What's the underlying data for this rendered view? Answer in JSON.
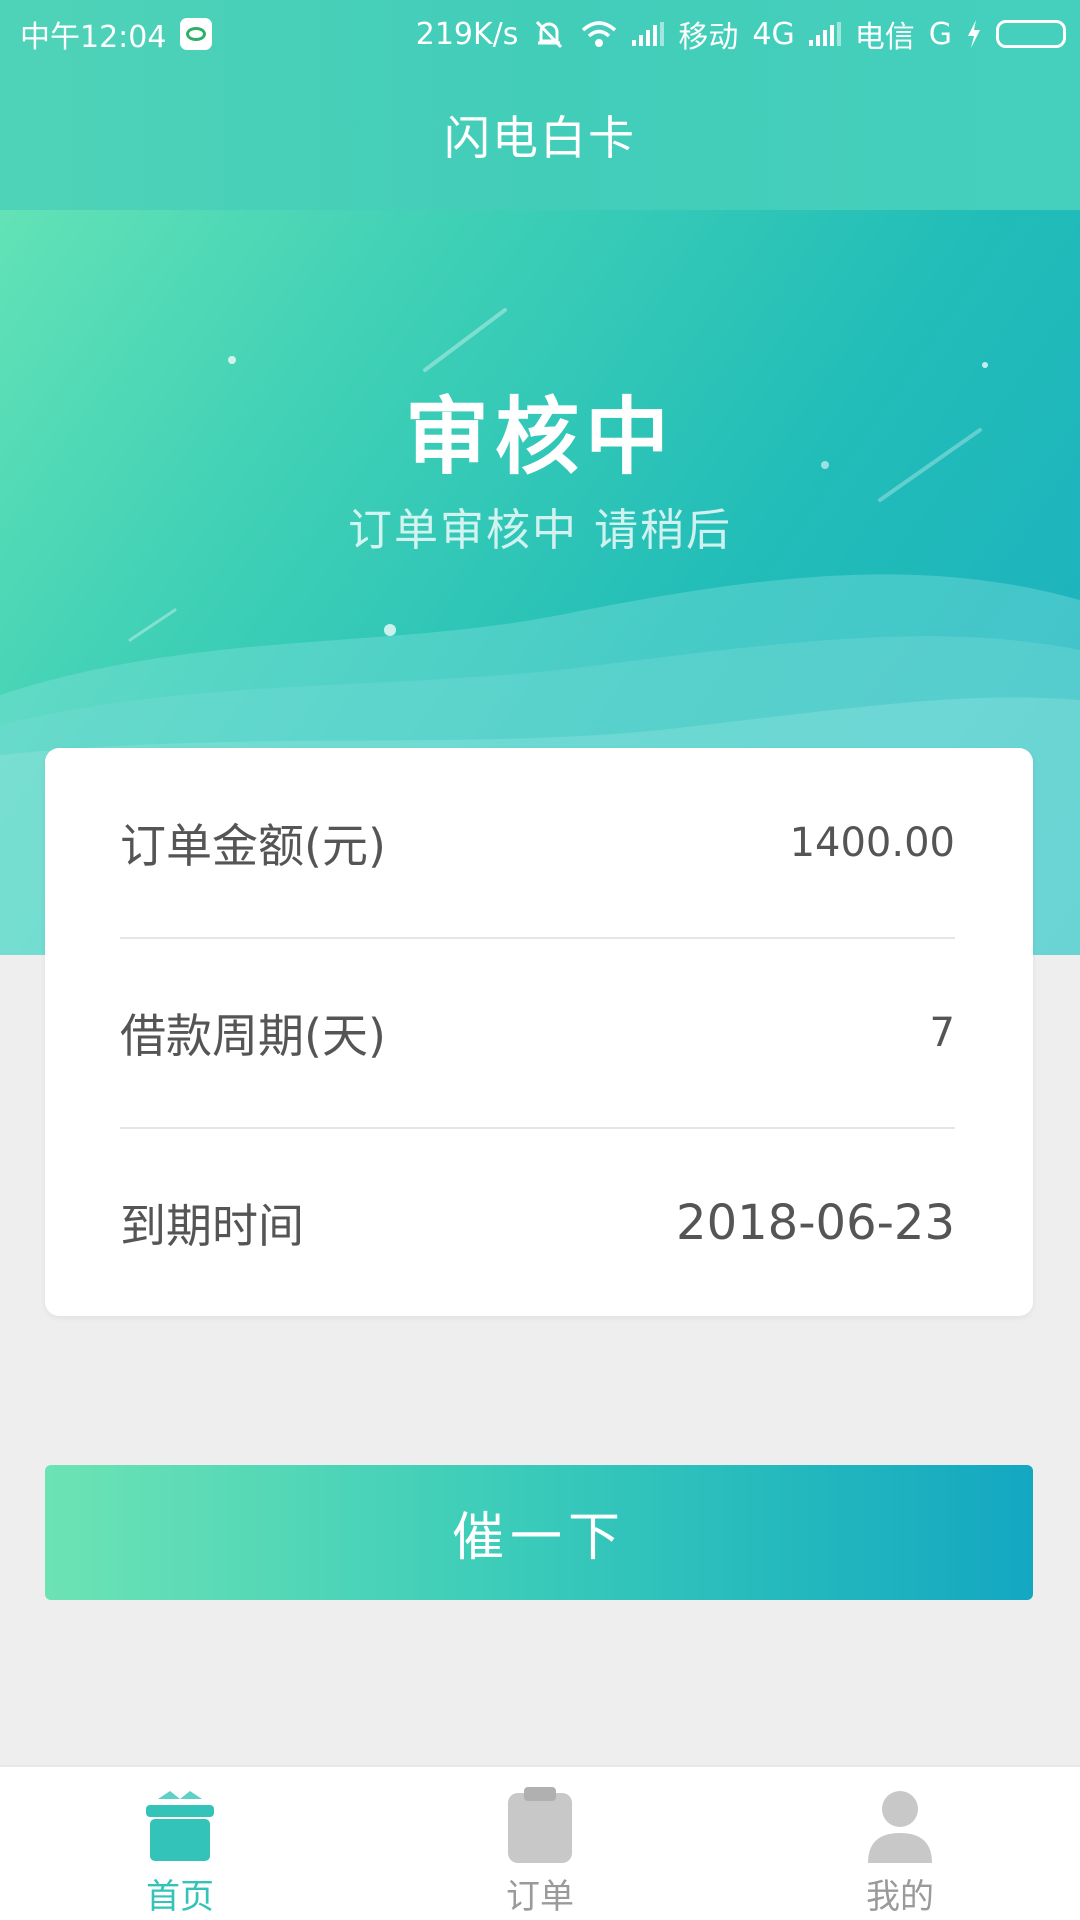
{
  "status_bar": {
    "time": "中午12:04",
    "net_speed": "219K/s",
    "carrier1": "移动",
    "network1": "4G",
    "carrier2": "电信",
    "network2": "G"
  },
  "header": {
    "app_title": "闪电白卡"
  },
  "hero": {
    "status_title": "审核中",
    "status_subtitle": "订单审核中 请稍后"
  },
  "order_card": {
    "rows": [
      {
        "label": "订单金额(元)",
        "value": "1400.00"
      },
      {
        "label": "借款周期(天)",
        "value": "7"
      },
      {
        "label": "到期时间",
        "value": "2018-06-23"
      }
    ]
  },
  "action": {
    "urge_label": "催一下"
  },
  "bottom_nav": {
    "items": [
      {
        "label": "首页",
        "icon": "home-gift-icon",
        "active": true
      },
      {
        "label": "订单",
        "icon": "clipboard-icon",
        "active": false
      },
      {
        "label": "我的",
        "icon": "user-icon",
        "active": false
      }
    ]
  },
  "colors": {
    "accent": "#33c3b9",
    "gradient_start": "#6de3b4",
    "gradient_end": "#14a7c2",
    "inactive": "#c8c8c8",
    "background": "#eeeeee"
  }
}
